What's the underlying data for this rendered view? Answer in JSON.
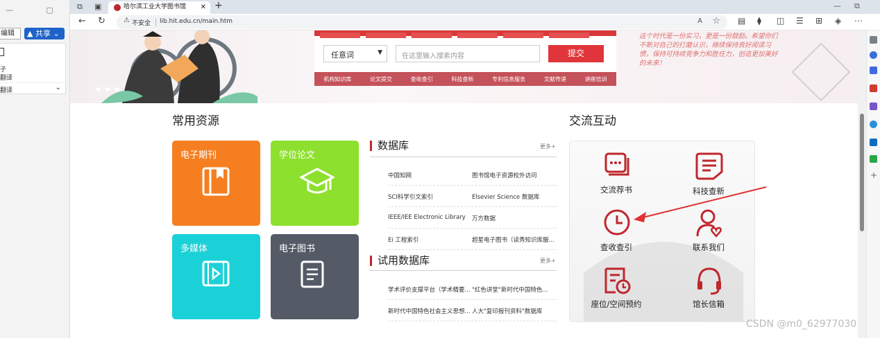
{
  "left_window": {
    "edit_label": "编辑",
    "share_label": "共享",
    "panel_line1": "子",
    "panel_line2": "翻译",
    "panel_line3": "翻译"
  },
  "browser": {
    "tab_title": "哈尔滨工业大学图书馆",
    "not_secure": "不安全",
    "url": "lib.hit.edu.cn/main.htm"
  },
  "search": {
    "select_value": "任意词",
    "placeholder": "在这里输入搜索内容",
    "submit": "提交",
    "links": [
      "机构知识库",
      "论文提交",
      "查收查引",
      "科技查新",
      "专利信息服务",
      "文献传递",
      "讲座培训"
    ]
  },
  "banner": {
    "poem": "这个时代是一份实习，更是一份鼓励。希望你们不断对自己的打磨认识，继续保持良好阅读习惯，保持可持续竞争力和胜任力，创造更加美好的未来！"
  },
  "sections": {
    "common": "常用资源",
    "interaction": "交流互动"
  },
  "tiles": [
    {
      "label": "电子期刊",
      "color": "#f57f20"
    },
    {
      "label": "学位论文",
      "color": "#8ee02e"
    },
    {
      "label": "多媒体",
      "color": "#1bd1d8"
    },
    {
      "label": "电子图书",
      "color": "#545b67"
    }
  ],
  "database": {
    "title": "数据库",
    "more": "更多+",
    "rows": [
      [
        "中国知网",
        "图书馆电子资源校外访问"
      ],
      [
        "SCI科学引文索引",
        "Elsevier Science 数据库"
      ],
      [
        "IEEE/IEE Electronic Library",
        "万方数据"
      ],
      [
        "Ei 工程索引",
        "超星电子图书（读秀知识库服..."
      ]
    ]
  },
  "trial": {
    "title": "试用数据库",
    "more": "更多+",
    "rows": [
      [
        "学术评价支撑平台（学术精要...",
        "\"红色讲堂\"新时代中国特色..."
      ],
      [
        "新时代中国特色社会主义思想...",
        "人大\"复印报刊资料\"数据库"
      ]
    ]
  },
  "interaction": [
    {
      "label": "交流荐书",
      "icon": "chat-icon"
    },
    {
      "label": "科技查新",
      "icon": "document-icon"
    },
    {
      "label": "查收查引",
      "icon": "clock-icon"
    },
    {
      "label": "联系我们",
      "icon": "user-heart-icon"
    },
    {
      "label": "座位/空间预约",
      "icon": "calendar-clock-icon"
    },
    {
      "label": "馆长信箱",
      "icon": "headset-icon"
    }
  ],
  "watermark": "CSDN @m0_62977030"
}
